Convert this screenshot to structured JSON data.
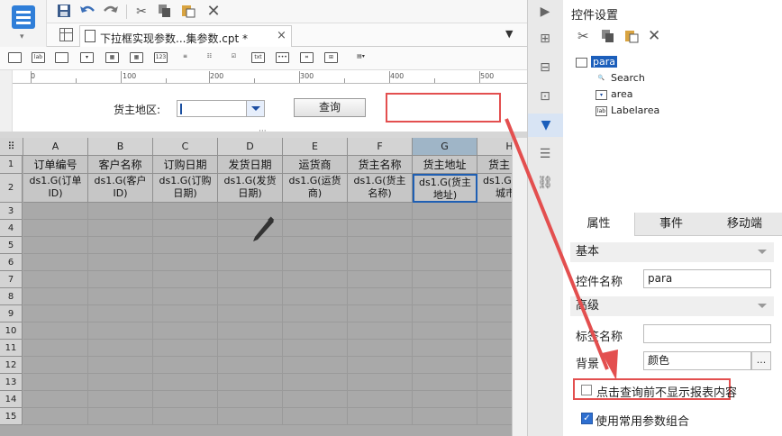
{
  "toolbar": {
    "icons": [
      "save-icon",
      "undo-icon",
      "redo-icon",
      "cut-icon",
      "copy-icon",
      "paste-icon",
      "delete-icon"
    ]
  },
  "tab": {
    "title": "下拉框实现参数...集参数.cpt *",
    "close": "×"
  },
  "ruler": {
    "ticks": [
      "0",
      "100",
      "200",
      "300",
      "400",
      "500"
    ]
  },
  "param": {
    "area_label": "货主地区:",
    "query_label": "查询"
  },
  "grid": {
    "columns": [
      "A",
      "B",
      "C",
      "D",
      "E",
      "F",
      "G",
      "H"
    ],
    "header_row": [
      "订单编号",
      "客户名称",
      "订购日期",
      "发货日期",
      "运货商",
      "货主名称",
      "货主地址",
      "货主"
    ],
    "data_row": [
      [
        "ds1.G(订单",
        "ID)"
      ],
      [
        "ds1.G(客户",
        "ID)"
      ],
      [
        "ds1.G(订购",
        "日期)"
      ],
      [
        "ds1.G(发货",
        "日期)"
      ],
      [
        "ds1.G(运货",
        "商)"
      ],
      [
        "ds1.G(货主",
        "名称)"
      ],
      [
        "ds1.G(货主",
        "地址)"
      ],
      [
        "ds1.G(",
        "城市"
      ]
    ],
    "rows": [
      "1",
      "2",
      "3",
      "4",
      "5",
      "6",
      "7",
      "8",
      "9",
      "10",
      "11",
      "12",
      "13",
      "14",
      "15"
    ]
  },
  "right_panel": {
    "title": "控件设置",
    "tree": {
      "root": "para",
      "children": [
        "Search",
        "area",
        "Labelarea"
      ]
    },
    "tabs": [
      "属性",
      "事件",
      "移动端"
    ],
    "sections": {
      "basic": "基本",
      "advanced": "高级"
    },
    "fields": {
      "name_label": "控件名称",
      "name_value": "para",
      "tag_label": "标签名称",
      "tag_value": "",
      "bg_label": "背景",
      "bg_value": "颜色",
      "bg_more": "..."
    },
    "checkbox_hide": "点击查询前不显示报表内容",
    "checkbox_common": "使用常用参数组合"
  },
  "accent_color": "#2e6fd0",
  "highlight_color": "#e34f4f"
}
